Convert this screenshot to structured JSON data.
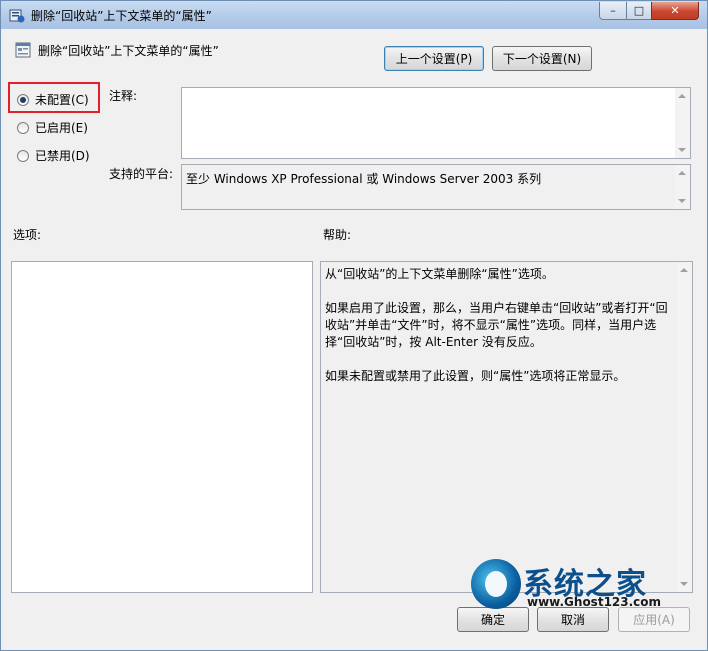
{
  "window": {
    "title": "删除“回收站”上下文菜单的“属性”",
    "min_label": "–",
    "max_label": "□",
    "close_label": "✕"
  },
  "header": {
    "title": "删除“回收站”上下文菜单的“属性”",
    "prev_button": "上一个设置(P)",
    "next_button": "下一个设置(N)"
  },
  "radios": {
    "not_configured": "未配置(C)",
    "enabled": "已启用(E)",
    "disabled": "已禁用(D)",
    "selected": "not_configured"
  },
  "comment": {
    "label": "注释:",
    "value": ""
  },
  "platform": {
    "label": "支持的平台:",
    "value": "至少 Windows XP Professional 或 Windows Server 2003 系列"
  },
  "options": {
    "label": "选项:"
  },
  "help": {
    "label": "帮助:",
    "paragraphs": [
      "从“回收站”的上下文菜单删除“属性”选项。",
      "如果启用了此设置，那么，当用户右键单击“回收站”或者打开“回收站”并单击“文件”时，将不显示“属性”选项。同样，当用户选择“回收站”时，按 Alt-Enter 没有反应。",
      "如果未配置或禁用了此设置，则“属性”选项将正常显示。"
    ]
  },
  "footer": {
    "ok": "确定",
    "cancel": "取消",
    "apply": "应用(A)"
  },
  "watermark": {
    "brand": "系统之家",
    "url": "www.Ghost123.com"
  },
  "colors": {
    "highlight": "#e0202a",
    "focus_button_border": "#3c7fb1"
  }
}
